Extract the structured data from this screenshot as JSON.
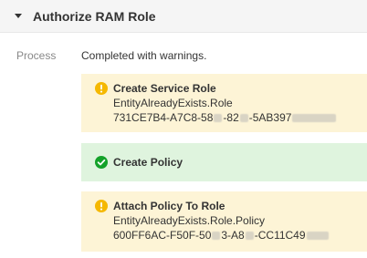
{
  "section": {
    "title": "Authorize RAM Role",
    "toggle_icon": "caret-down-icon"
  },
  "process": {
    "label": "Process",
    "status": "Completed with warnings."
  },
  "steps": [
    {
      "status": "warning",
      "icon": "warning-icon",
      "title": "Create Service Role",
      "message": "EntityAlreadyExists.Role",
      "request_id_parts": [
        "731CE7B4-A7C8-58",
        "-82",
        "-5AB397"
      ]
    },
    {
      "status": "success",
      "icon": "check-circle-icon",
      "title": "Create Policy"
    },
    {
      "status": "warning",
      "icon": "warning-icon",
      "title": "Attach Policy To Role",
      "message": "EntityAlreadyExists.Role.Policy",
      "request_id_parts": [
        "600FF6AC-F50F-50",
        "3-A8",
        "-CC11C49"
      ]
    }
  ],
  "colors": {
    "warning_bg": "#fdf4d6",
    "success_bg": "#dff4de",
    "warning_icon": "#f5b800",
    "success_icon": "#14a22a"
  }
}
